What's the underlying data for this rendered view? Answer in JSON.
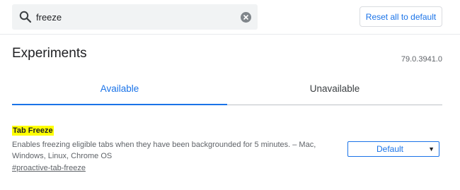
{
  "search": {
    "value": "freeze"
  },
  "header": {
    "reset_label": "Reset all to default"
  },
  "page": {
    "title": "Experiments",
    "version": "79.0.3941.0"
  },
  "tabs": [
    {
      "label": "Available",
      "selected": true
    },
    {
      "label": "Unavailable",
      "selected": false
    }
  ],
  "experiment": {
    "name": "Tab Freeze",
    "description": "Enables freezing eligible tabs when they have been backgrounded for 5 minutes. – Mac, Windows, Linux, Chrome OS",
    "link": "#proactive-tab-freeze",
    "selected_value": "Default"
  },
  "colors": {
    "accent": "#1a73e8",
    "highlight": "#ffff00",
    "search_bg": "#f1f3f4"
  },
  "icons": {
    "search": "search-icon",
    "clear": "clear-search-icon",
    "dropdown": "dropdown-arrow-icon"
  }
}
